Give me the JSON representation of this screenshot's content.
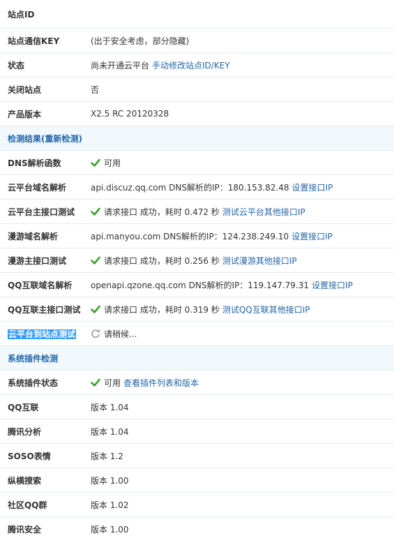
{
  "site_info": {
    "site_id_label": "站点ID",
    "site_key_label": "站点通信KEY",
    "site_key_value": "(出于安全考虑，部分隐藏)",
    "status_label": "状态",
    "status_value": "尚未开通云平台",
    "status_link": "手动修改站点ID/KEY",
    "close_label": "关闭站点",
    "close_value": "否",
    "version_label": "产品版本",
    "version_value": "X2.5 RC 20120328"
  },
  "detection": {
    "title": "检测结果(重新检测)",
    "rows": [
      {
        "label": "DNS解析函数",
        "text": "可用",
        "link": ""
      },
      {
        "label": "云平台域名解析",
        "text": "api.discuz.qq.com DNS解析的IP：180.153.82.48",
        "link": "设置接口IP"
      },
      {
        "label": "云平台主接口测试",
        "text": "请求接口 成功，耗时 0.472 秒",
        "link": "测试云平台其他接口IP"
      },
      {
        "label": "漫游域名解析",
        "text": "api.manyou.com DNS解析的IP：124.238.249.10",
        "link": "设置接口IP"
      },
      {
        "label": "漫游主接口测试",
        "text": "请求接口 成功，耗时 0.256 秒",
        "link": "测试漫游其他接口IP"
      },
      {
        "label": "QQ互联域名解析",
        "text": "openapi.qzone.qq.com DNS解析的IP：119.147.79.31",
        "link": "设置接口IP"
      },
      {
        "label": "QQ互联主接口测试",
        "text": "请求接口 成功，耗时 0.319 秒",
        "link": "测试QQ互联其他接口IP"
      },
      {
        "label": "云平台到站点测试",
        "text": "请稍候...",
        "link": ""
      }
    ]
  },
  "plugins": {
    "title": "系统插件检测",
    "status_label": "系统插件状态",
    "status_text": "可用",
    "status_link": "查看插件列表和版本",
    "items": [
      {
        "label": "QQ互联",
        "value": "版本 1.04"
      },
      {
        "label": "腾讯分析",
        "value": "版本 1.04"
      },
      {
        "label": "SOSO表情",
        "value": "版本 1.2"
      },
      {
        "label": "纵横搜索",
        "value": "版本 1.00"
      },
      {
        "label": "社区QQ群",
        "value": "版本 1.02"
      },
      {
        "label": "腾讯安全",
        "value": "版本 1.00"
      }
    ]
  },
  "colors": {
    "link": "#2366a8",
    "section_bg": "#f2f9fd",
    "check": "#3aa02a",
    "highlight": "#3399ff"
  },
  "icons": {
    "ok": "check-icon",
    "loading": "refresh-spinner-icon"
  }
}
